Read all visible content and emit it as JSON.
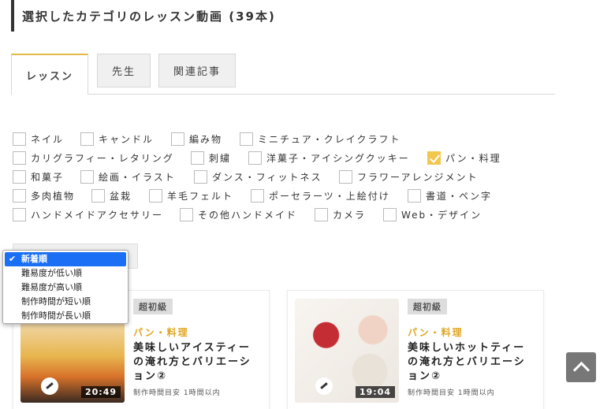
{
  "heading": "選択したカテゴリのレッスン動画 (39本)",
  "tabs": [
    "レッスン",
    "先生",
    "関連記事"
  ],
  "categories": [
    [
      "ネイル",
      "キャンドル",
      "編み物",
      "ミニチュア・クレイクラフト"
    ],
    [
      "カリグラフィー・レタリング",
      "刺繍",
      "洋菓子・アイシングクッキー",
      "パン・料理"
    ],
    [
      "和菓子",
      "絵画・イラスト",
      "ダンス・フィットネス",
      "フラワーアレンジメント"
    ],
    [
      "多肉植物",
      "盆栽",
      "羊毛フェルト",
      "ポーセラーツ・上絵付け",
      "書道・ペン字"
    ],
    [
      "ハンドメイドアクセサリー",
      "その他ハンドメイド",
      "カメラ",
      "Web・デザイン"
    ]
  ],
  "checked_category": "パン・料理",
  "sort": {
    "options": [
      "新着順",
      "難易度が低い順",
      "難易度が高い順",
      "制作時間が短い順",
      "制作時間が長い順"
    ],
    "selected": "新着順"
  },
  "cards": [
    {
      "level": "超初級",
      "category": "パン・料理",
      "title": "美味しいアイスティーの淹れ方とバリエーション②",
      "duration": "20:49",
      "time": "制作時間目安 1時間以内"
    },
    {
      "level": "超初級",
      "category": "パン・料理",
      "title": "美味しいホットティーの淹れ方とバリエーション②",
      "duration": "19:04",
      "time": "制作時間目安 1時間以内"
    }
  ],
  "icons": {
    "checkbox": "checkbox-icon",
    "check": "check-icon",
    "scroll_top": "arrow-up-icon"
  },
  "colors": {
    "accent": "#f1c750",
    "category_tag": "#e0a624",
    "dropdown_selected": "#1a6ff5"
  }
}
